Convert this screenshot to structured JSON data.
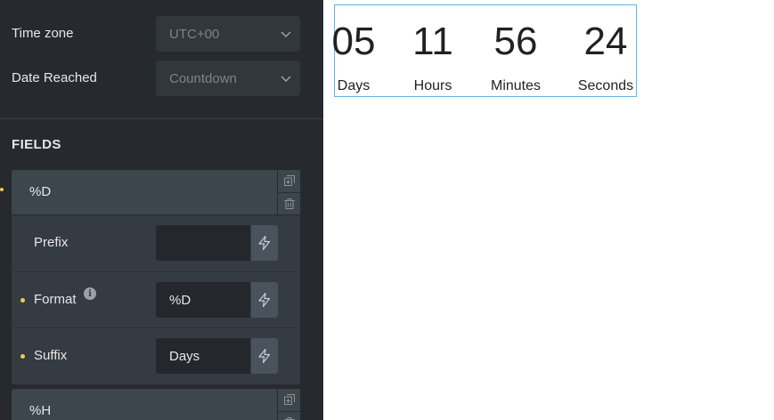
{
  "settings": {
    "timezone": {
      "label": "Time zone",
      "value": "UTC+00"
    },
    "date_reached": {
      "label": "Date Reached",
      "value": "Countdown"
    }
  },
  "fields_title": "FIELDS",
  "fields": [
    {
      "name": "%D",
      "prefix": {
        "label": "Prefix",
        "value": ""
      },
      "format": {
        "label": "Format",
        "value": "%D"
      },
      "suffix": {
        "label": "Suffix",
        "value": "Days"
      }
    },
    {
      "name": "%H"
    }
  ],
  "icons": {
    "chevron": "chevron-down-icon",
    "duplicate": "duplicate-icon",
    "delete": "trash-icon",
    "dynamic": "lightning-bolt-icon",
    "info": "info-icon"
  },
  "countdown": {
    "units": [
      {
        "value": "05",
        "label": "Days"
      },
      {
        "value": "11",
        "label": "Hours"
      },
      {
        "value": "56",
        "label": "Minutes"
      },
      {
        "value": "24",
        "label": "Seconds"
      }
    ]
  },
  "colors": {
    "panel_bg": "#262a2f",
    "accent_dot": "#f2c94c",
    "selection_outline": "#5fb4e8"
  }
}
